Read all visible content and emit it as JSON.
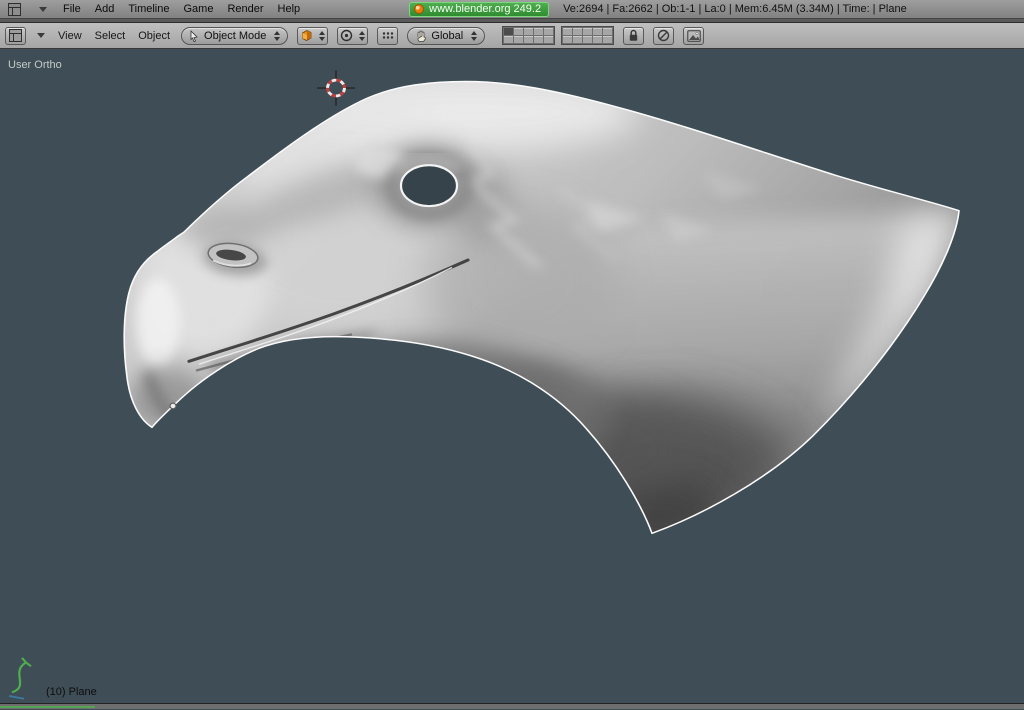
{
  "topbar": {
    "menus": [
      "File",
      "Add",
      "Timeline",
      "Game",
      "Render",
      "Help"
    ],
    "version": "www.blender.org 249.2",
    "stats": "Ve:2694 | Fa:2662 | Ob:1-1 | La:0 | Mem:6.45M (3.34M) | Time: | Plane"
  },
  "viewport_header": {
    "menus": [
      "View",
      "Select",
      "Object"
    ],
    "mode": "Object Mode",
    "orientation": "Global",
    "active_layer": 1,
    "layer_count": 20
  },
  "viewport": {
    "view_label": "User Ortho",
    "object_label": "(10) Plane",
    "background_color": "#3f4e56",
    "selection_outline_color": "#fbfbfb",
    "cursor_color": "#c04040",
    "axis_gizmo_color": "#4fae4f",
    "badge_green": "#2f8b2f",
    "blender_orange": "#e87d0d"
  }
}
